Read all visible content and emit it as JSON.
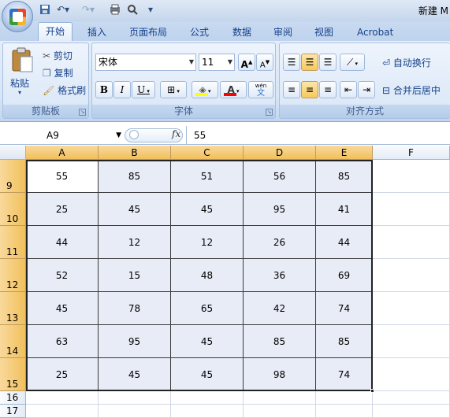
{
  "window": {
    "title": "新建 M"
  },
  "tabs": [
    "开始",
    "插入",
    "页面布局",
    "公式",
    "数据",
    "审阅",
    "视图",
    "Acrobat"
  ],
  "clipboard": {
    "paste": "粘贴",
    "cut": "剪切",
    "copy": "复制",
    "format_painter": "格式刷",
    "label": "剪贴板"
  },
  "font": {
    "name": "宋体",
    "size": "11",
    "bold": "B",
    "italic": "I",
    "underline": "U",
    "label": "字体",
    "phonetic": "wén"
  },
  "alignment": {
    "wrap": "自动换行",
    "merge": "合并后居中",
    "label": "对齐方式"
  },
  "formula_bar": {
    "name_box": "A9",
    "fx": "fx",
    "value": "55"
  },
  "columns": [
    "A",
    "B",
    "C",
    "D",
    "E",
    "F"
  ],
  "rows": [
    {
      "num": "9",
      "cells": [
        "55",
        "85",
        "51",
        "56",
        "85"
      ]
    },
    {
      "num": "10",
      "cells": [
        "25",
        "45",
        "45",
        "95",
        "41"
      ]
    },
    {
      "num": "11",
      "cells": [
        "44",
        "12",
        "12",
        "26",
        "44"
      ]
    },
    {
      "num": "12",
      "cells": [
        "52",
        "15",
        "48",
        "36",
        "69"
      ]
    },
    {
      "num": "13",
      "cells": [
        "45",
        "78",
        "65",
        "42",
        "74"
      ]
    },
    {
      "num": "14",
      "cells": [
        "63",
        "95",
        "45",
        "85",
        "85"
      ]
    },
    {
      "num": "15",
      "cells": [
        "25",
        "45",
        "45",
        "98",
        "74"
      ]
    },
    {
      "num": "16",
      "cells": []
    },
    {
      "num": "17",
      "cells": []
    }
  ],
  "selection": {
    "range": "A9:E15",
    "active_cell": "A9"
  },
  "colors": {
    "header_selected": "#f1c05c",
    "selection_fill": "#e8ecf6",
    "ribbon": "#d7e5f6",
    "font_color_bar": "#ff0000",
    "fill_color_bar": "#ffff00"
  }
}
